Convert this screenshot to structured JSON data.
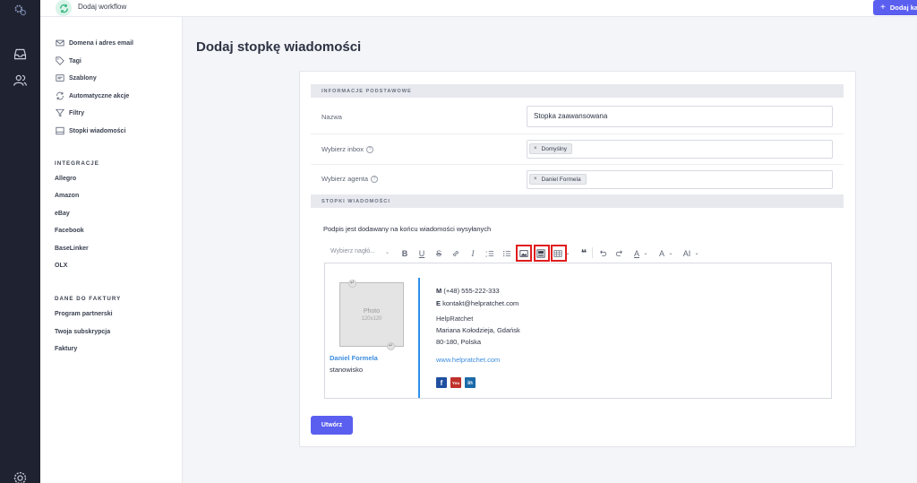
{
  "topbar": {
    "workflow_label": "Dodaj workflow",
    "add_button_label": "Dodaj ka"
  },
  "sidebar": {
    "items": [
      {
        "label": "Domena i adres email",
        "icon": "mail-domain-icon"
      },
      {
        "label": "Tagi",
        "icon": "tag-icon"
      },
      {
        "label": "Szablony",
        "icon": "template-icon"
      },
      {
        "label": "Automatyczne akcje",
        "icon": "refresh-icon"
      },
      {
        "label": "Filtry",
        "icon": "filter-icon"
      },
      {
        "label": "Stopki wiadomości",
        "icon": "footer-icon"
      }
    ],
    "integrations_heading": "INTEGRACJE",
    "integrations": [
      "Allegro",
      "Amazon",
      "eBay",
      "Facebook",
      "BaseLinker",
      "OLX"
    ],
    "invoice_heading": "DANE DO FAKTURY",
    "invoice_items": [
      "Program partnerski",
      "Twoja subskrypcja",
      "Faktury"
    ]
  },
  "page": {
    "title": "Dodaj stopkę wiadomości"
  },
  "form": {
    "basic_heading": "INFORMACJE PODSTAWOWE",
    "name_label": "Nazwa",
    "name_value": "Stopka zaawansowana",
    "inbox_label": "Wybierz inbox",
    "inbox_chip": "Domyślny",
    "agent_label": "Wybierz agenta",
    "agent_chip": "Daniel Formela",
    "footers_heading": "STOPKI WIADOMOŚCI",
    "info_text": "Podpis jest dodawany na końcu wiadomości wysyłanych",
    "heading_select": "Wybierz nagłó...",
    "submit_label": "Utwórz"
  },
  "toolbar": {
    "bold": "B",
    "underline": "U",
    "strike": "S",
    "italic": "I",
    "quote": "❝",
    "font_color": "A",
    "font_size": "A",
    "font_family": "AI"
  },
  "signature": {
    "photo_label": "Photo",
    "photo_size": "120x120",
    "name": "Daniel Formela",
    "role": "stanowisko",
    "phone_prefix": "M",
    "phone": "(+48) 555-222-333",
    "email_prefix": "E",
    "email": "kontakt@helpratchet.com",
    "company": "HelpRatchet",
    "address_line1": "Mariana Kołodzieja, Gdańsk",
    "address_line2": "80-180, Polska",
    "website": "www.helpratchet.com",
    "social": {
      "facebook": "f",
      "youtube": "You",
      "linkedin": "in"
    }
  },
  "colors": {
    "accent": "#5b5ff0",
    "link": "#3c8dde",
    "highlight_box": "#e01d1d",
    "rail": "#1f2230"
  }
}
